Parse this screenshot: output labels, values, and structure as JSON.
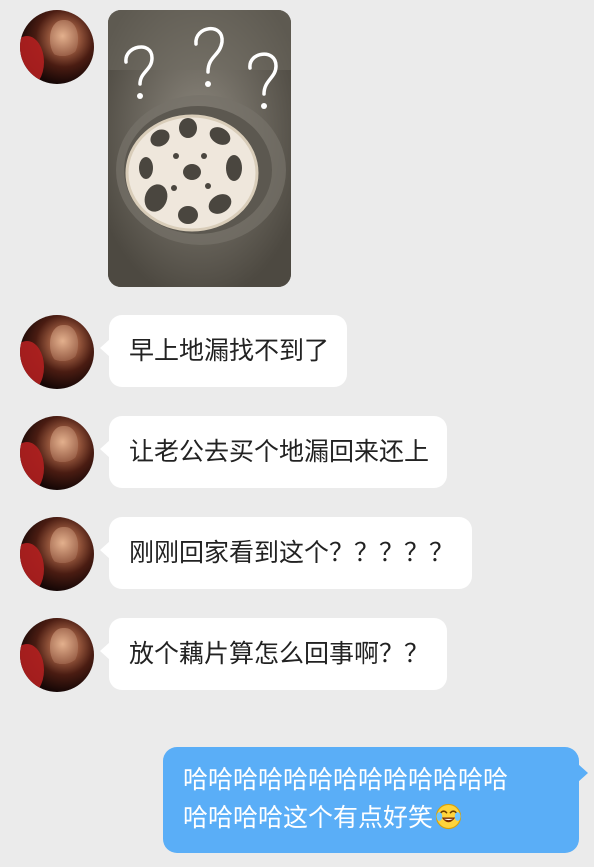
{
  "messages": [
    {
      "sender": "other",
      "type": "image",
      "image_icon": "lotus-root-drain-image"
    },
    {
      "sender": "other",
      "type": "text",
      "text": "早上地漏找不到了"
    },
    {
      "sender": "other",
      "type": "text",
      "text": "让老公去买个地漏回来还上"
    },
    {
      "sender": "other",
      "type": "text",
      "text": "刚刚回家看到这个？？？？？"
    },
    {
      "sender": "other",
      "type": "text",
      "text": "放个藕片算怎么回事啊？？"
    },
    {
      "sender": "self",
      "type": "text",
      "lines": [
        "哈哈哈哈哈哈哈哈哈哈哈哈哈",
        "哈哈哈哈这个有点好笑"
      ],
      "trailing_icon": "laughing-crying-emoji-icon"
    }
  ],
  "colors": {
    "background": "#ebebeb",
    "incoming_bubble": "#ffffff",
    "outgoing_bubble": "#5aaef7",
    "incoming_text": "#222222",
    "outgoing_text": "#ffffff"
  }
}
